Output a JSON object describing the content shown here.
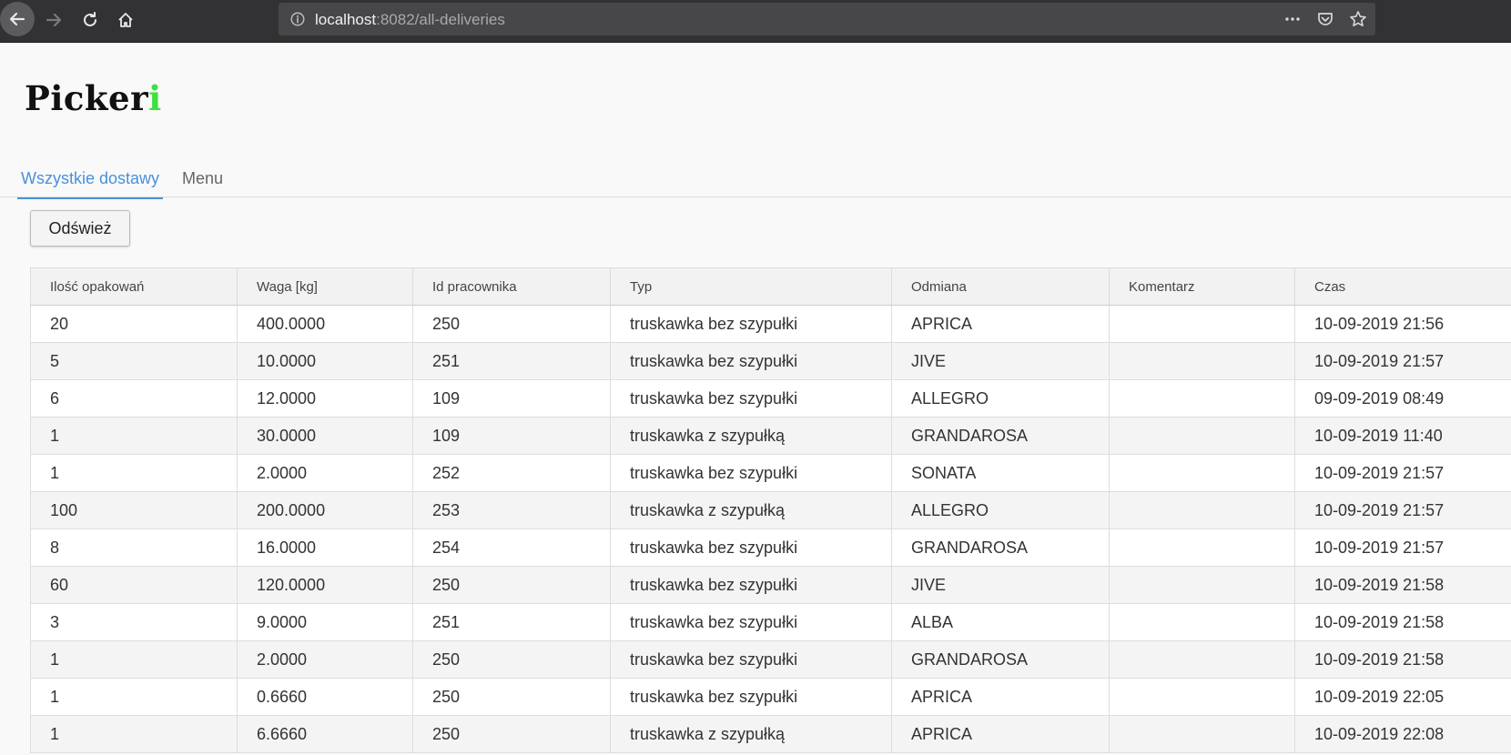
{
  "browser": {
    "url_host": "localhost",
    "url_rest": ":8082/all-deliveries"
  },
  "app": {
    "logo_main": "Picker",
    "logo_accent": "i",
    "accent_color": "#3fe03f"
  },
  "tabs": [
    {
      "label": "Wszystkie dostawy",
      "active": true
    },
    {
      "label": "Menu",
      "active": false
    }
  ],
  "toolbar": {
    "refresh_label": "Odśwież"
  },
  "table": {
    "columns": [
      "Ilość opakowań",
      "Waga [kg]",
      "Id pracownika",
      "Typ",
      "Odmiana",
      "Komentarz",
      "Czas"
    ],
    "rows": [
      [
        "20",
        "400.0000",
        "250",
        "truskawka bez szypułki",
        "APRICA",
        "",
        "10-09-2019 21:56"
      ],
      [
        "5",
        "10.0000",
        "251",
        "truskawka bez szypułki",
        "JIVE",
        "",
        "10-09-2019 21:57"
      ],
      [
        "6",
        "12.0000",
        "109",
        "truskawka bez szypułki",
        "ALLEGRO",
        "",
        "09-09-2019 08:49"
      ],
      [
        "1",
        "30.0000",
        "109",
        "truskawka z szypułką",
        "GRANDAROSA",
        "",
        "10-09-2019 11:40"
      ],
      [
        "1",
        "2.0000",
        "252",
        "truskawka bez szypułki",
        "SONATA",
        "",
        "10-09-2019 21:57"
      ],
      [
        "100",
        "200.0000",
        "253",
        "truskawka z szypułką",
        "ALLEGRO",
        "",
        "10-09-2019 21:57"
      ],
      [
        "8",
        "16.0000",
        "254",
        "truskawka bez szypułki",
        "GRANDAROSA",
        "",
        "10-09-2019 21:57"
      ],
      [
        "60",
        "120.0000",
        "250",
        "truskawka bez szypułki",
        "JIVE",
        "",
        "10-09-2019 21:58"
      ],
      [
        "3",
        "9.0000",
        "251",
        "truskawka bez szypułki",
        "ALBA",
        "",
        "10-09-2019 21:58"
      ],
      [
        "1",
        "2.0000",
        "250",
        "truskawka bez szypułki",
        "GRANDAROSA",
        "",
        "10-09-2019 21:58"
      ],
      [
        "1",
        "0.6660",
        "250",
        "truskawka bez szypułki",
        "APRICA",
        "",
        "10-09-2019 22:05"
      ],
      [
        "1",
        "6.6660",
        "250",
        "truskawka z szypułką",
        "APRICA",
        "",
        "10-09-2019 22:08"
      ]
    ]
  }
}
